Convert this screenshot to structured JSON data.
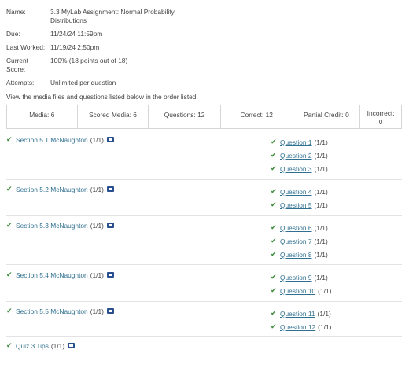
{
  "info": {
    "name_label": "Name:",
    "name_line1": "3.3 MyLab Assignment: Normal Probability",
    "name_line2": "Distributions",
    "due_label": "Due:",
    "due_value": "11/24/24 11:59pm",
    "last_label": "Last Worked:",
    "last_value": "11/19/24 2:50pm",
    "score_label1": "Current",
    "score_label2": "Score:",
    "score_value": "100% (18 points out of 18)",
    "attempts_label": "Attempts:",
    "attempts_value": "Unlimited per question",
    "note": "View the media files and questions listed below in the order listed."
  },
  "stats": {
    "media": "Media: 6",
    "scored_media": "Scored Media: 6",
    "questions": "Questions: 12",
    "correct": "Correct: 12",
    "partial": "Partial Credit: 0",
    "incorrect_line1": "Incorrect:",
    "incorrect_line2": "0"
  },
  "sections": [
    {
      "title": "Section 5.1 McNaughton",
      "score": "(1/1)",
      "questions": [
        {
          "label": "Question 1",
          "score": "(1/1)"
        },
        {
          "label": "Question 2",
          "score": "(1/1)"
        },
        {
          "label": "Question 3",
          "score": "(1/1)"
        }
      ]
    },
    {
      "title": "Section 5.2 McNaughton",
      "score": "(1/1)",
      "questions": [
        {
          "label": "Question 4",
          "score": "(1/1)"
        },
        {
          "label": "Question 5",
          "score": "(1/1)"
        }
      ]
    },
    {
      "title": "Section 5.3 McNaughton",
      "score": "(1/1)",
      "questions": [
        {
          "label": "Question 6",
          "score": "(1/1)"
        },
        {
          "label": "Question 7",
          "score": "(1/1)"
        },
        {
          "label": "Question 8",
          "score": "(1/1)"
        }
      ]
    },
    {
      "title": "Section 5.4 McNaughton",
      "score": "(1/1)",
      "questions": [
        {
          "label": "Question 9",
          "score": "(1/1)"
        },
        {
          "label": "Question 10",
          "score": "(1/1)"
        }
      ]
    },
    {
      "title": "Section 5.5 McNaughton",
      "score": "(1/1)",
      "questions": [
        {
          "label": "Question 11",
          "score": "(1/1)"
        },
        {
          "label": "Question 12",
          "score": "(1/1)"
        }
      ]
    }
  ],
  "quiz": {
    "title": "Quiz 3 Tips",
    "score": "(1/1)"
  },
  "icons": {
    "check": "check-icon",
    "media": "media-icon"
  },
  "colors": {
    "check": "#3b8b3b",
    "link": "#2f6f8f",
    "media_icon": "#2a4f8e"
  }
}
